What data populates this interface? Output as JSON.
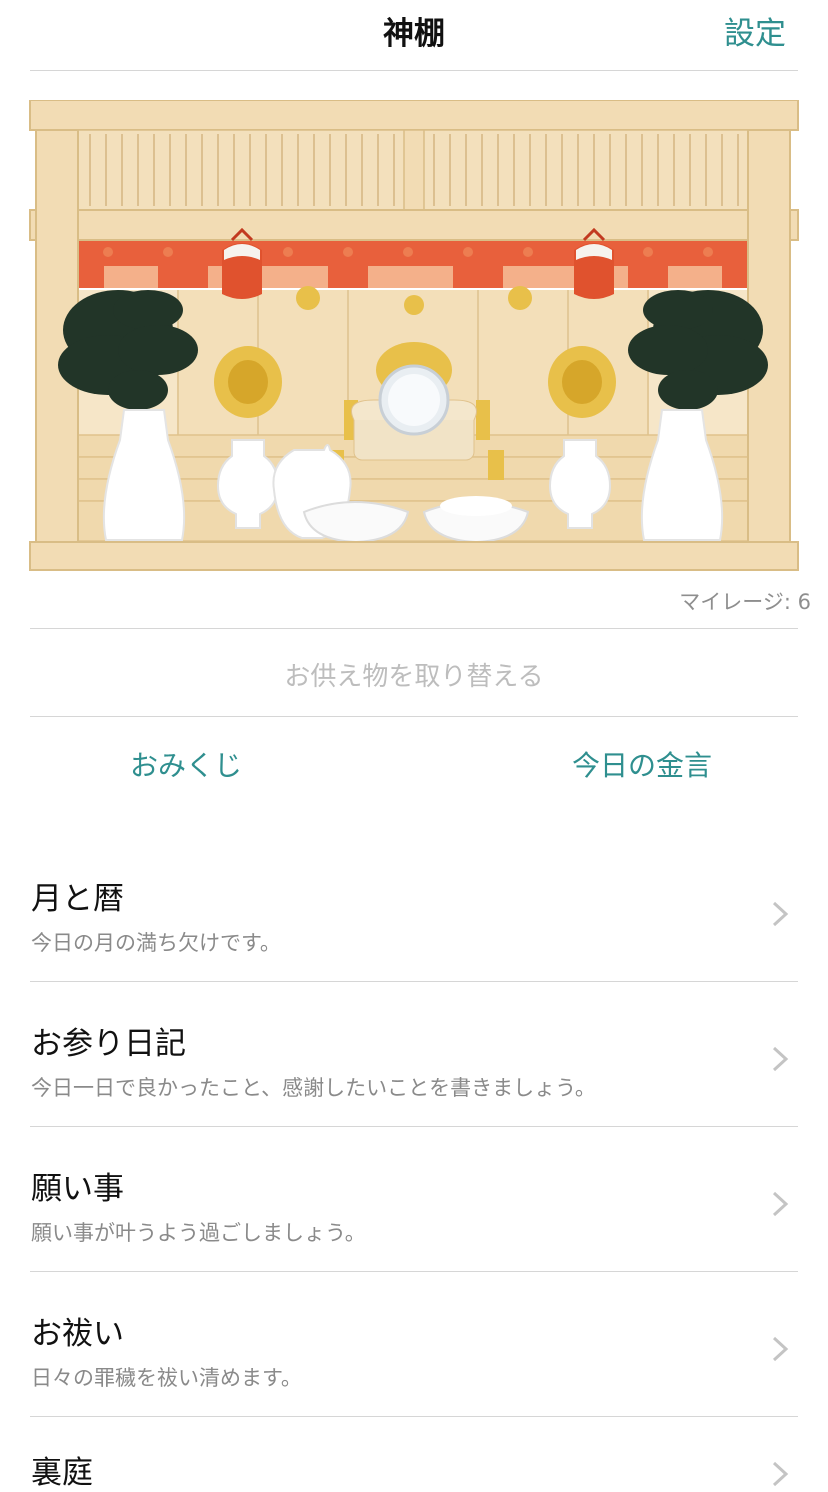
{
  "nav": {
    "title": "神棚",
    "settings": "設定"
  },
  "shrine": {
    "mileage": "マイレージ: 6",
    "offer": "お供え物を取り替える"
  },
  "actions": {
    "omikuji": "おみくじ",
    "kingen": "今日の金言"
  },
  "menu": [
    {
      "title": "月と暦",
      "subtitle": "今日の月の満ち欠けです。"
    },
    {
      "title": "お参り日記",
      "subtitle": "今日一日で良かったこと、感謝したいことを書きましょう。"
    },
    {
      "title": "願い事",
      "subtitle": "願い事が叶うよう過ごしましょう。"
    },
    {
      "title": "お祓い",
      "subtitle": "日々の罪穢を祓い清めます。"
    },
    {
      "title": "裏庭",
      "subtitle": ""
    }
  ],
  "colors": {
    "accent": "#2f8f8f",
    "wood": "#f2dcb4",
    "curtain": "#e8603c",
    "sakaki": "#223528",
    "gold": "#e8c04a"
  }
}
